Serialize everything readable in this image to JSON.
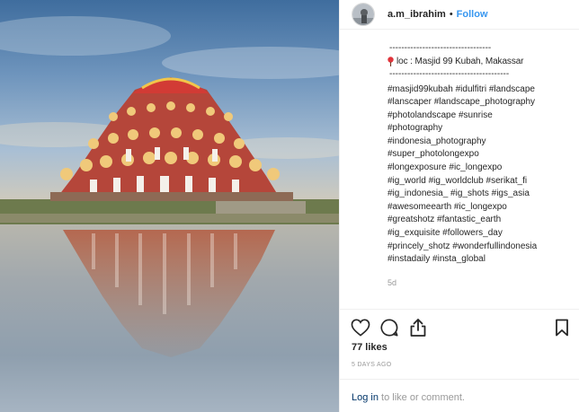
{
  "post": {
    "username": "a.m_ibrahim",
    "separator": "•",
    "follow_label": "Follow",
    "photo_icon": "mosque-landscape-photo",
    "avatar_icon": "profile-avatar"
  },
  "caption": {
    "dash_line_1": "----------------------------------",
    "location": "loc : Masjid 99 Kubah, Makassar",
    "dash_line_2": "----------------------------------------",
    "hashtags": [
      "#masjid99kubah #idulfitri #landscape",
      "#lanscaper #landscape_photography",
      "#photolandscape #sunrise",
      "#photography",
      "#indonesia_photography",
      "#super_photolongexpo",
      "#longexposure #ic_longexpo",
      "#ig_world #ig_worldclub #serikat_fi",
      "#ig_indonesia_ #ig_shots #igs_asia",
      "#awesomeearth #ic_longexpo",
      "#greatshotz #fantastic_earth",
      "#ig_exquisite #followers_day",
      "#princely_shotz #wonderfullindonesia",
      "#instadaily #insta_global"
    ],
    "time_ago": "5d"
  },
  "actions": {
    "like_icon": "heart-icon",
    "comment_icon": "comment-icon",
    "share_icon": "share-icon",
    "save_icon": "bookmark-icon"
  },
  "likes": "77 likes",
  "posted": "5 DAYS AGO",
  "login": {
    "link": "Log in",
    "rest": " to like or comment."
  },
  "colors": {
    "follow": "#3897f0",
    "link": "#003569",
    "muted": "#999999",
    "pin": "#e0343b"
  }
}
